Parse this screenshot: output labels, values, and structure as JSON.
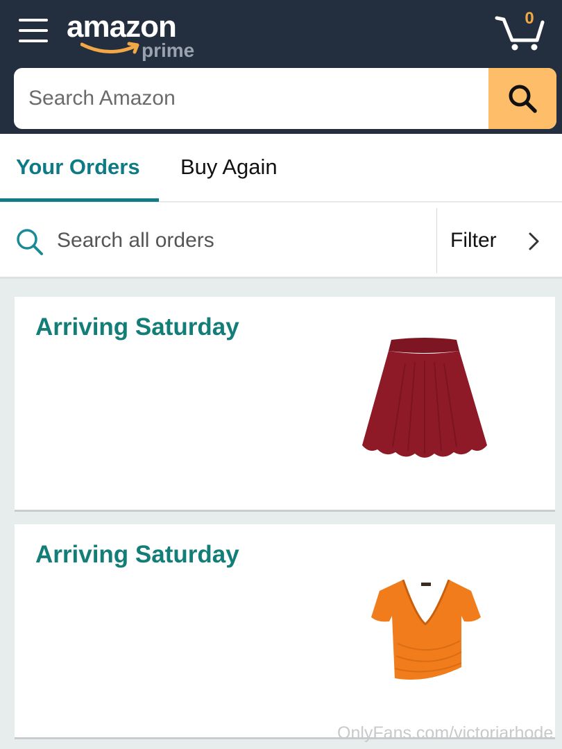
{
  "header": {
    "logo_word": "amazon",
    "logo_sub": "prime",
    "cart_count": "0"
  },
  "search": {
    "placeholder": "Search Amazon"
  },
  "tabs": [
    {
      "label": "Your Orders",
      "active": true
    },
    {
      "label": "Buy Again",
      "active": false
    }
  ],
  "order_search": {
    "placeholder": "Search all orders",
    "filter_label": "Filter"
  },
  "orders": [
    {
      "status": "Arriving Saturday",
      "item_icon": "red-skater-skirt",
      "item_color": "#8e1a27"
    },
    {
      "status": "Arriving Saturday",
      "item_icon": "orange-wrap-crop-top",
      "item_color": "#f07c1c"
    }
  ],
  "watermark": "OnlyFans.com/victoriarhode",
  "colors": {
    "header_bg": "#232f3e",
    "search_button": "#febd69",
    "accent_teal": "#127b87",
    "status_teal": "#137d78"
  }
}
